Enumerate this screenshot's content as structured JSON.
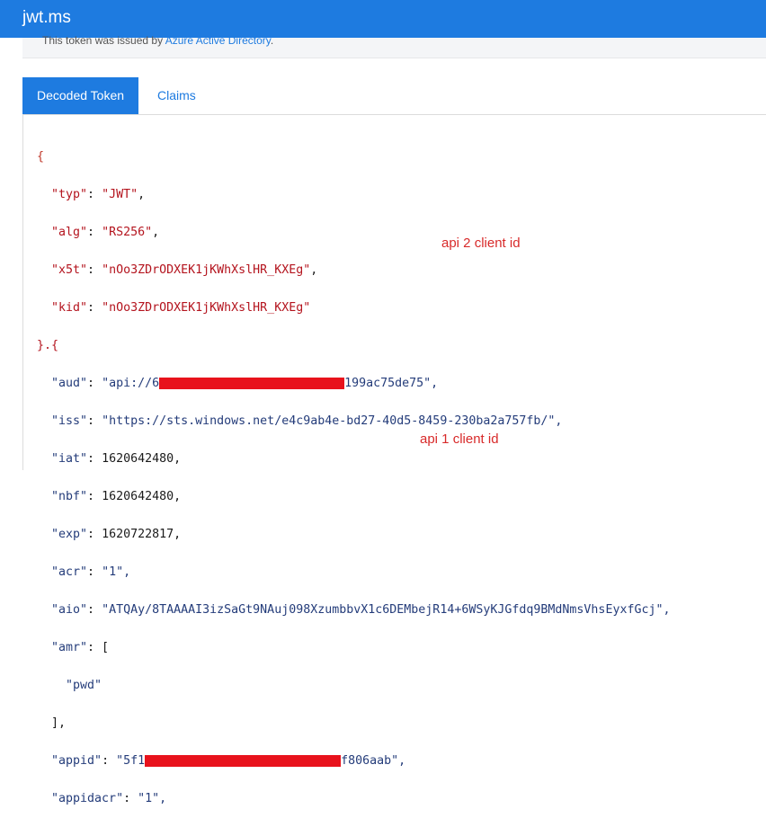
{
  "header": {
    "brand": "jwt.ms"
  },
  "issuer": {
    "prefix": "This token was issued by ",
    "provider": "Azure Active Directory",
    "suffix": "."
  },
  "tabs": [
    {
      "label": "Decoded Token",
      "active": true
    },
    {
      "label": "Claims",
      "active": false
    }
  ],
  "token": {
    "header": {
      "typ": "\"JWT\"",
      "alg": "\"RS256\"",
      "x5t": "\"nOo3ZDrODXEK1jKWhXslHR_KXEg\"",
      "kid": "\"nOo3ZDrODXEK1jKWhXslHR_KXEg\""
    },
    "payload": {
      "aud_prefix": "\"api://6",
      "aud_suffix": "199ac75de75\",",
      "iss": "\"https://sts.windows.net/e4c9ab4e-bd27-40d5-8459-230ba2a757fb/\",",
      "iat": "1620642480,",
      "nbf": "1620642480,",
      "exp": "1620722817,",
      "acr": "\"1\",",
      "aio": "\"ATQAy/8TAAAAI3izSaGt9NAuj098XzumbbvX1c6DEMbejR14+6WSyKJGfdq9BMdNmsVhsEyxfGcj\",",
      "amr_value": "\"pwd\"",
      "appid_prefix": "\"5f1",
      "appid_suffix": "f806aab\",",
      "appidacr": "\"1\","
    }
  },
  "annotations": {
    "aud_note": "api 2 client id",
    "appid_note": "api 1 client id"
  },
  "colors": {
    "accent": "#1e7be0",
    "redaction": "#e8121c",
    "annotation": "#d82a2a"
  }
}
